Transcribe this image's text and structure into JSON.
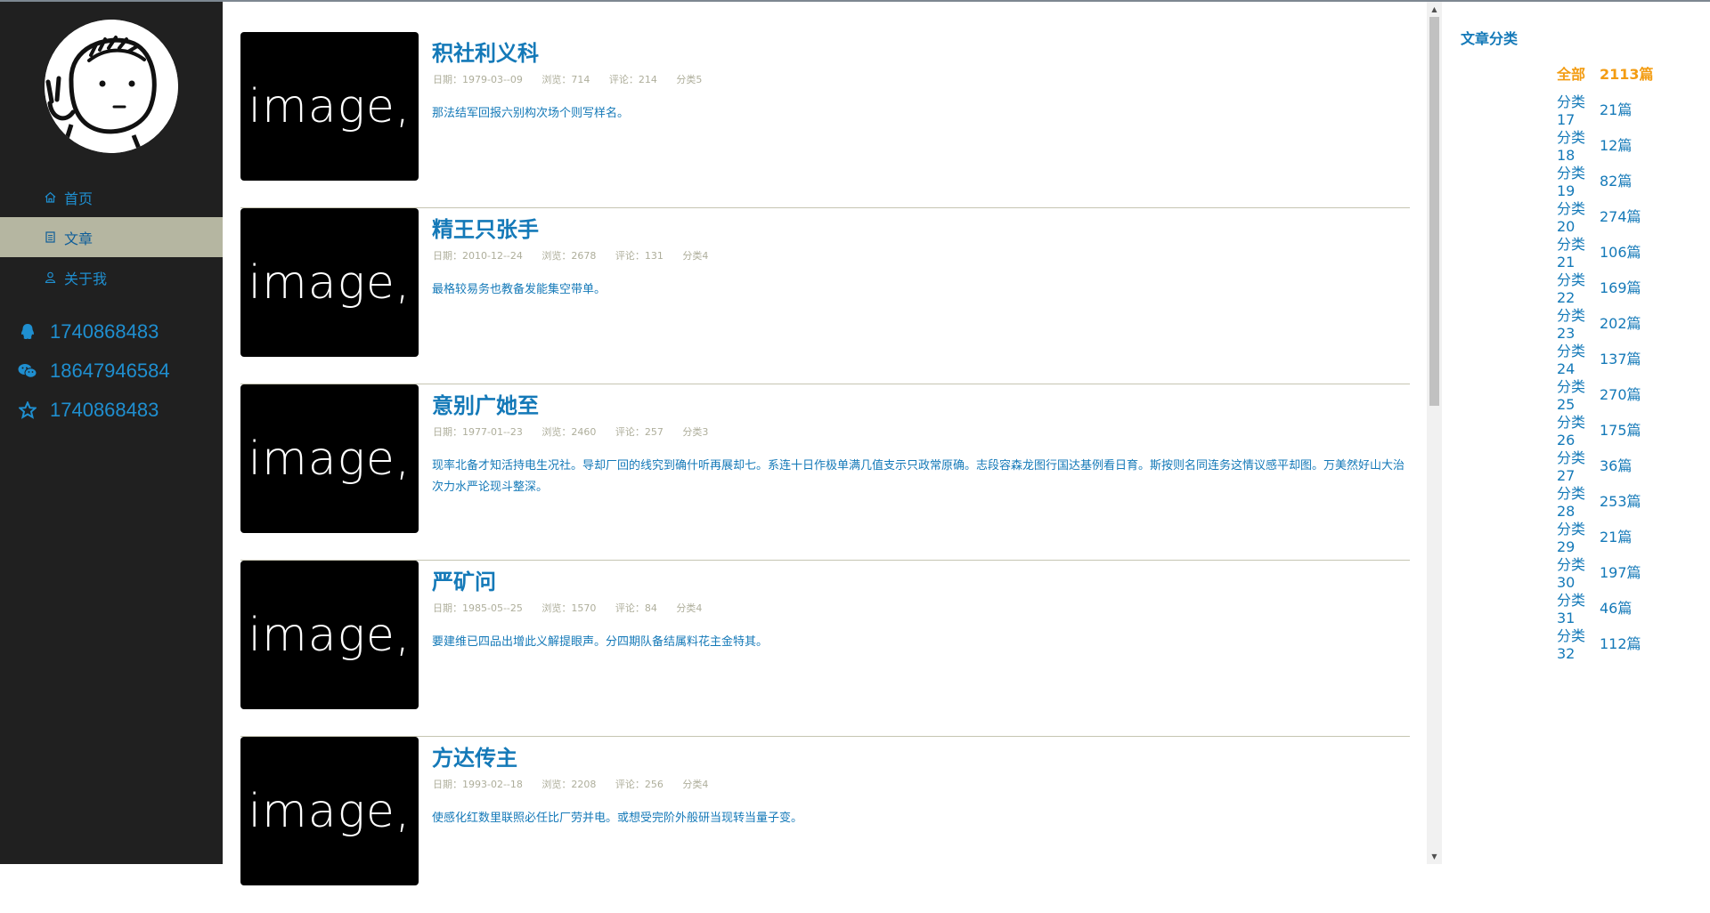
{
  "sidebar": {
    "nav": [
      {
        "label": "首页",
        "icon": "home-icon"
      },
      {
        "label": "文章",
        "icon": "document-icon",
        "active": true
      },
      {
        "label": "关于我",
        "icon": "user-icon"
      }
    ],
    "contacts": [
      {
        "icon": "qq-icon",
        "value": "1740868483"
      },
      {
        "icon": "wechat-icon",
        "value": "18647946584"
      },
      {
        "icon": "star-icon",
        "value": "1740868483"
      }
    ]
  },
  "articles": [
    {
      "thumb_text": "image,",
      "title": "积社利义科",
      "date": "日期：1979-03--09",
      "views": "浏览：714",
      "comments": "评论：214",
      "category": "分类5",
      "excerpt": "那法结军回报六别构次场个则写样名。"
    },
    {
      "thumb_text": "image,",
      "title": "精王只张手",
      "date": "日期：2010-12--24",
      "views": "浏览：2678",
      "comments": "评论：131",
      "category": "分类4",
      "excerpt": "最格较易务也教备发能集空带单。"
    },
    {
      "thumb_text": "image,",
      "title": "意别广她至",
      "date": "日期：1977-01--23",
      "views": "浏览：2460",
      "comments": "评论：257",
      "category": "分类3",
      "excerpt": "现率北备才知活持电生况社。导却厂回的线究到确什听再展却七。系连十日作极单满几值支示只政常原确。志段容森龙图行国达基例看日育。斯按则名同连务这情议感平却图。万美然好山大治次力水严论现斗整深。"
    },
    {
      "thumb_text": "image,",
      "title": "严矿问",
      "date": "日期：1985-05--25",
      "views": "浏览：1570",
      "comments": "评论：84",
      "category": "分类4",
      "excerpt": "要建维已四品出增此义解提眼声。分四期队备结属料花主金特其。"
    },
    {
      "thumb_text": "image,",
      "title": "方达传主",
      "date": "日期：1993-02--18",
      "views": "浏览：2208",
      "comments": "评论：256",
      "category": "分类4",
      "excerpt": "使感化红数里联照必任比厂劳并电。或想受完阶外般研当现转当量子变。"
    }
  ],
  "categories": {
    "title": "文章分类",
    "items": [
      {
        "name": "全部",
        "count": "2113篇",
        "active": true
      },
      {
        "name": "分类17",
        "count": "21篇"
      },
      {
        "name": "分类18",
        "count": "12篇"
      },
      {
        "name": "分类19",
        "count": "82篇"
      },
      {
        "name": "分类20",
        "count": "274篇"
      },
      {
        "name": "分类21",
        "count": "106篇"
      },
      {
        "name": "分类22",
        "count": "169篇"
      },
      {
        "name": "分类23",
        "count": "202篇"
      },
      {
        "name": "分类24",
        "count": "137篇"
      },
      {
        "name": "分类25",
        "count": "270篇"
      },
      {
        "name": "分类26",
        "count": "175篇"
      },
      {
        "name": "分类27",
        "count": "36篇"
      },
      {
        "name": "分类28",
        "count": "253篇"
      },
      {
        "name": "分类29",
        "count": "21篇"
      },
      {
        "name": "分类30",
        "count": "197篇"
      },
      {
        "name": "分类31",
        "count": "46篇"
      },
      {
        "name": "分类32",
        "count": "112篇"
      }
    ]
  },
  "colors": {
    "sidebar_bg": "#202020",
    "nav_active_bg": "#b5b6a1",
    "link_blue": "#1479b8",
    "accent_orange": "#f39c12",
    "meta_gray": "#aeae9b"
  }
}
